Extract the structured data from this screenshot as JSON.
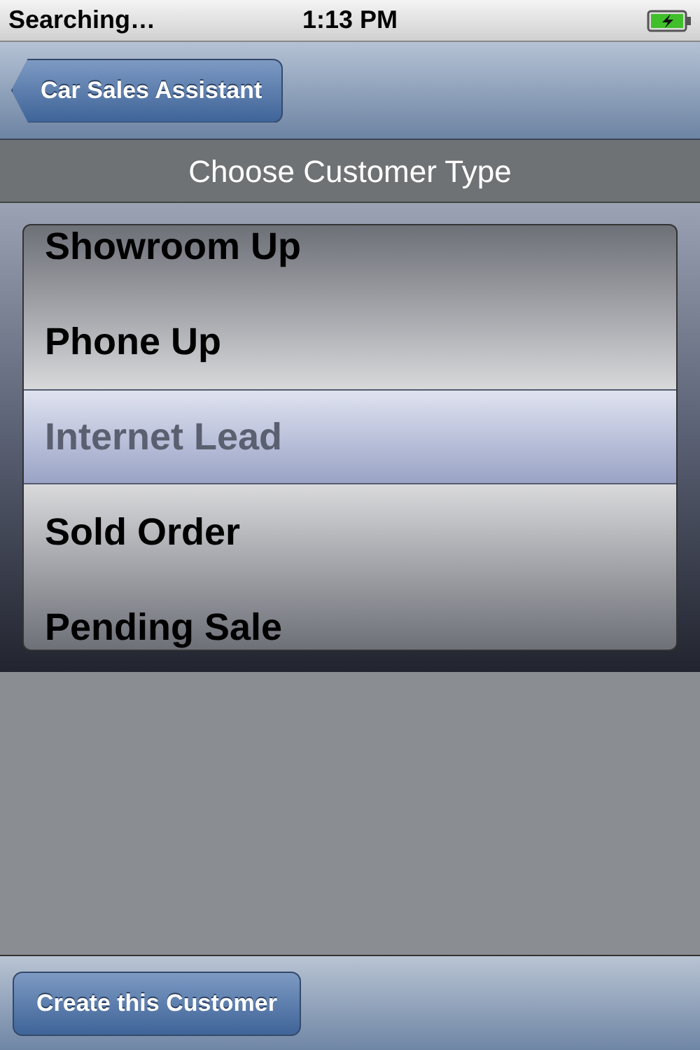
{
  "status_bar": {
    "carrier": "Searching…",
    "time": "1:13 PM"
  },
  "nav_bar": {
    "back_button": "Car Sales Assistant"
  },
  "prompt": "Choose Customer Type",
  "picker": {
    "items": [
      {
        "label": "Showroom Up",
        "selected": false
      },
      {
        "label": "Phone Up",
        "selected": false
      },
      {
        "label": "Internet Lead",
        "selected": true
      },
      {
        "label": "Sold Order",
        "selected": false
      },
      {
        "label": "Pending Sale",
        "selected": false
      }
    ]
  },
  "toolbar": {
    "button": "Create this Customer"
  }
}
